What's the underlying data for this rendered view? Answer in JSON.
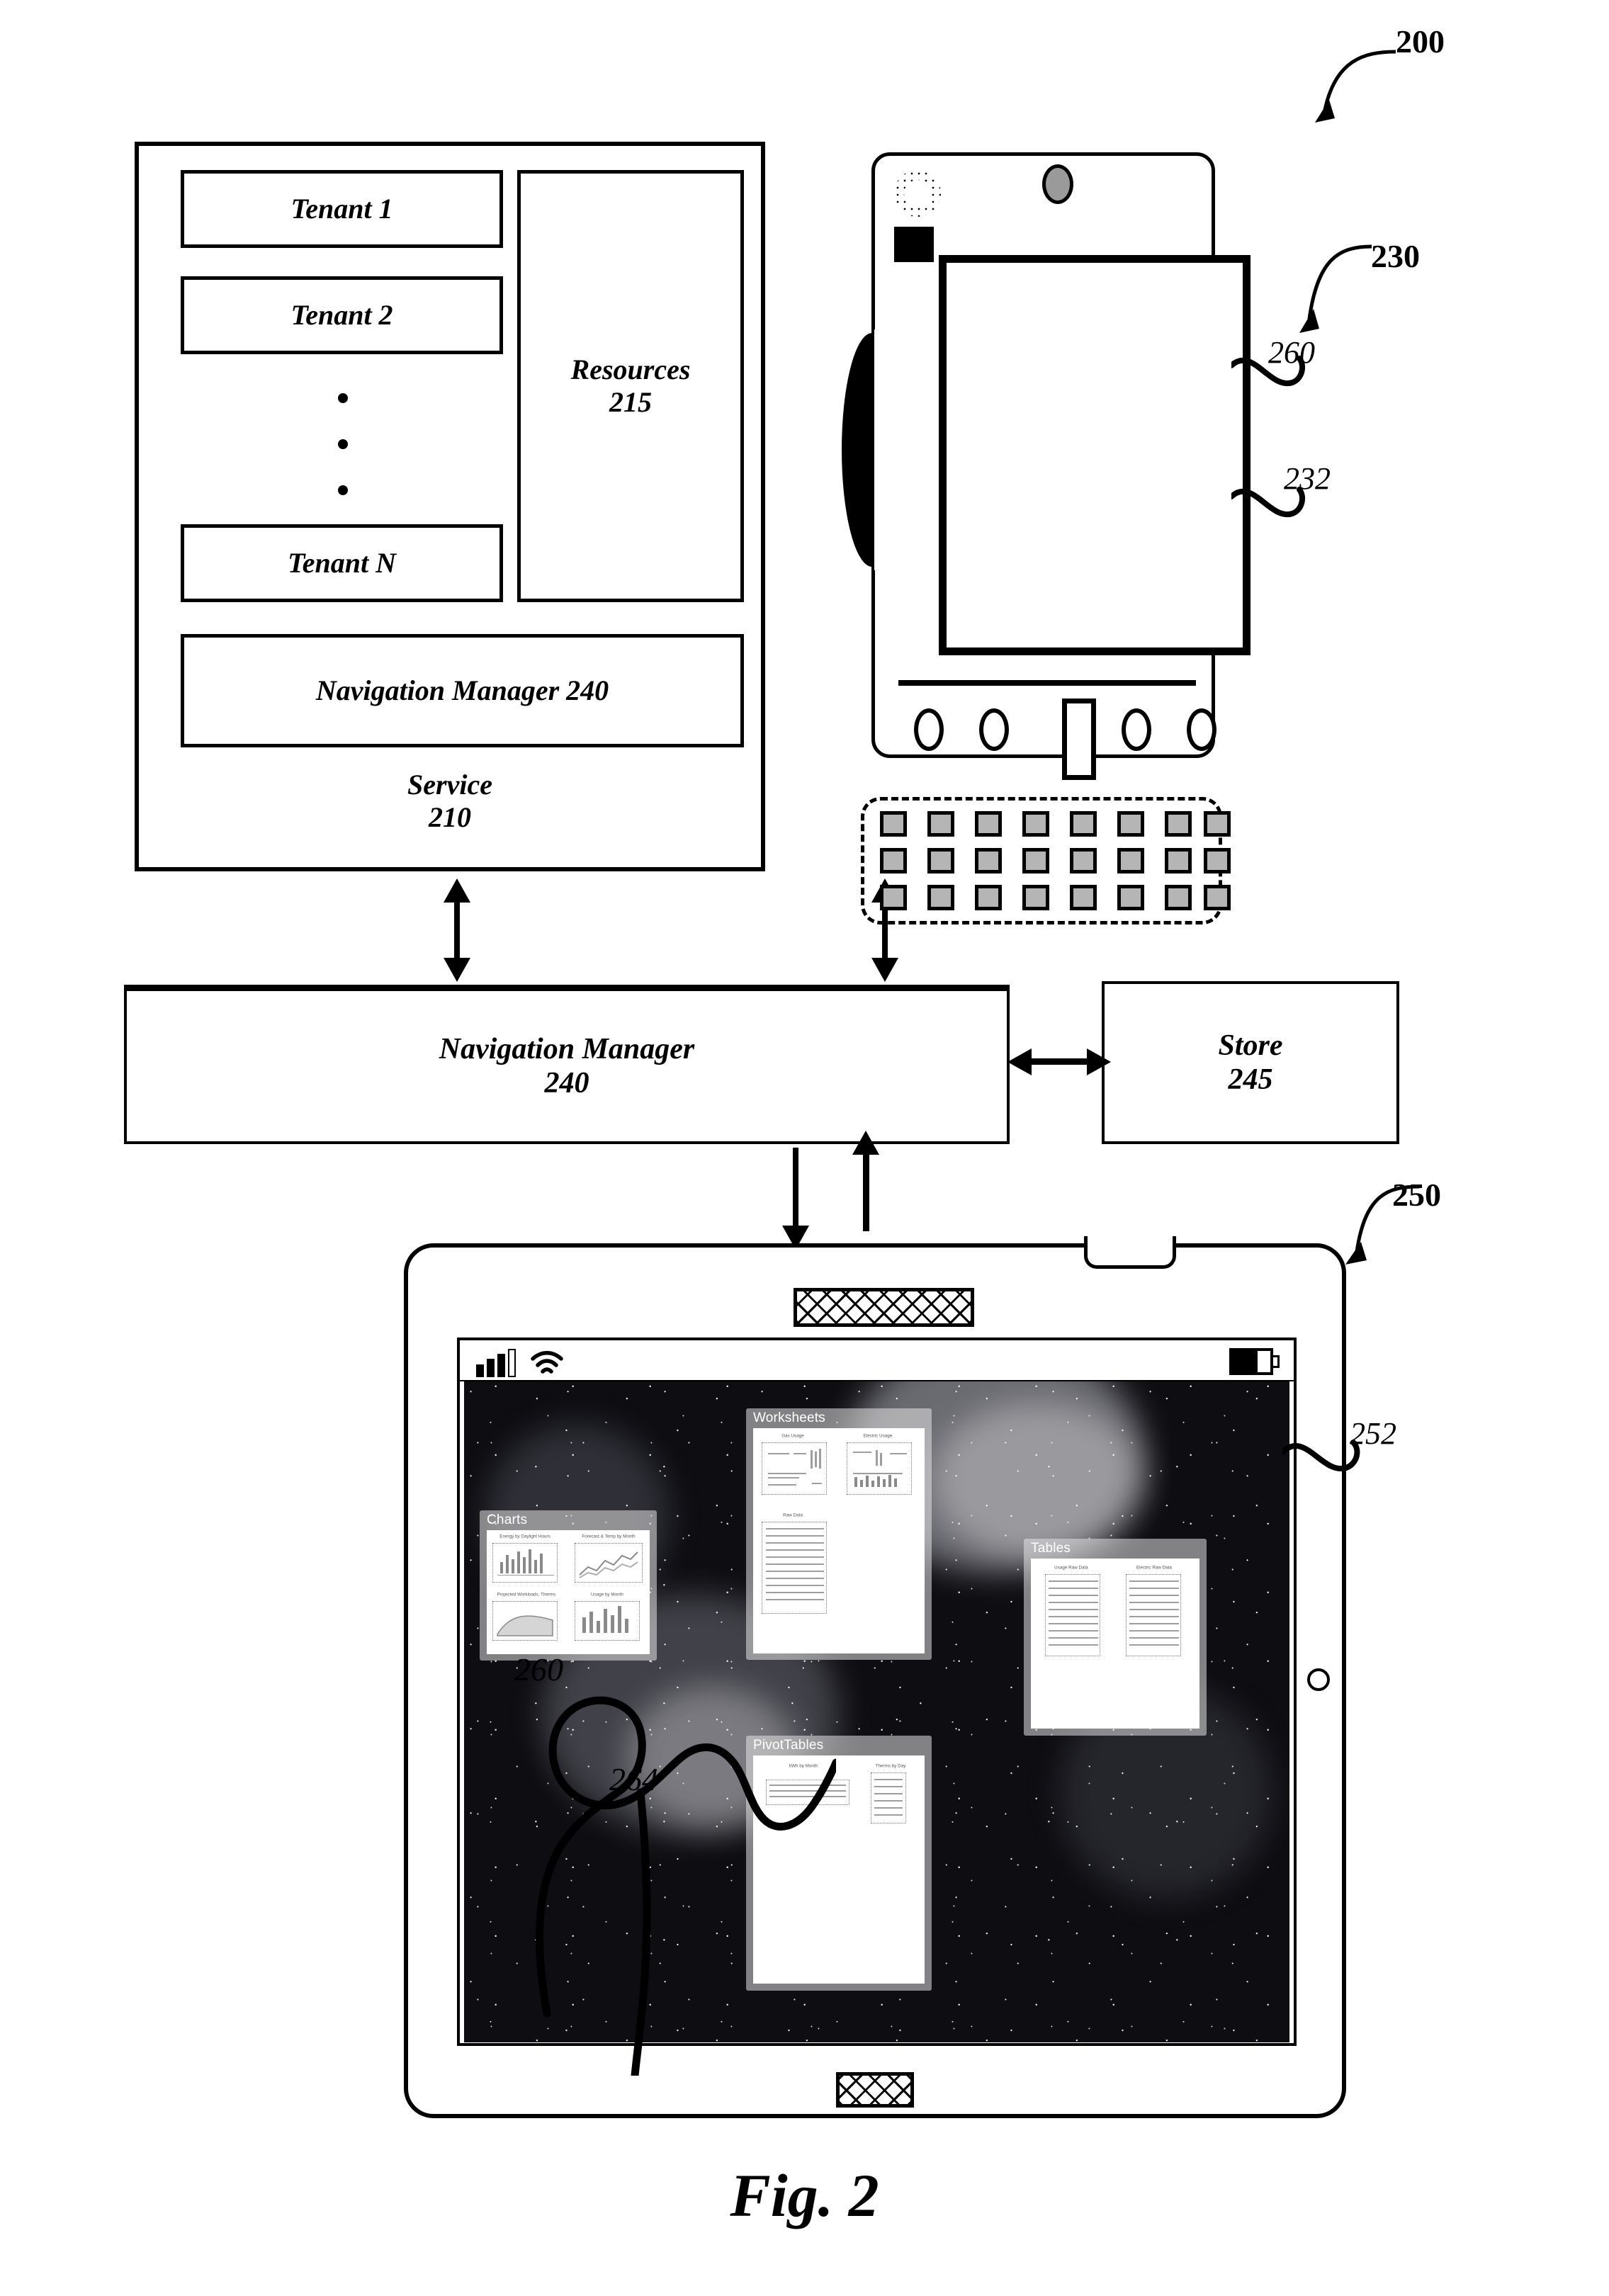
{
  "figure": {
    "caption": "Fig. 2",
    "system_ref": "200"
  },
  "service": {
    "title": "Service",
    "ref": "210",
    "tenants": [
      {
        "label": "Tenant 1"
      },
      {
        "label": "Tenant 2"
      },
      {
        "label": "Tenant N"
      }
    ],
    "resources": {
      "label": "Resources",
      "ref": "215"
    },
    "navigation_manager": {
      "label": "Navigation Manager 240"
    }
  },
  "navigation_manager": {
    "label": "Navigation Manager",
    "ref": "240"
  },
  "store": {
    "label": "Store",
    "ref": "245"
  },
  "phone_device": {
    "ref": "230",
    "screen_ref": "232",
    "ui_ref": "260"
  },
  "tablet_device": {
    "ref": "250",
    "screen_ref": "252",
    "ui_ref": "260",
    "gesture_ref": "264",
    "status_bar": {
      "signal_icon": "signal-bars-icon",
      "signal_bars_filled": 3,
      "signal_bars_total": 4,
      "wifi_icon": "wifi-icon",
      "battery_icon": "battery-icon",
      "battery_level_pct": 65
    },
    "panels": [
      {
        "title": "Charts",
        "thumbnails": [
          {
            "caption": "Energy by Daylight Hours",
            "kind": "line"
          },
          {
            "caption": "Forecast & Temp by Month",
            "kind": "area"
          },
          {
            "caption": "Projected Workloads, Therms",
            "kind": "line"
          },
          {
            "caption": "Usage by Month",
            "kind": "bar"
          }
        ]
      },
      {
        "title": "Worksheets",
        "thumbnails": [
          {
            "caption": "Gas Usage",
            "kind": "sheet"
          },
          {
            "caption": "Electric Usage",
            "kind": "sheet"
          },
          {
            "caption": "Raw Data",
            "kind": "grid"
          }
        ]
      },
      {
        "title": "Tables",
        "thumbnails": [
          {
            "caption": "Usage Raw Data",
            "kind": "table"
          },
          {
            "caption": "Electric Raw Data",
            "kind": "table"
          }
        ]
      },
      {
        "title": "PivotTables",
        "thumbnails": [
          {
            "caption": "kWh by Month",
            "kind": "pivot"
          },
          {
            "caption": "Therms by Day",
            "kind": "pivot"
          }
        ]
      }
    ]
  },
  "colors": {
    "ink": "#000000",
    "key_fill": "#b5b5b5",
    "panel_fill": "rgba(228,228,228,0.55)",
    "wallpaper": "#0d0d12"
  }
}
